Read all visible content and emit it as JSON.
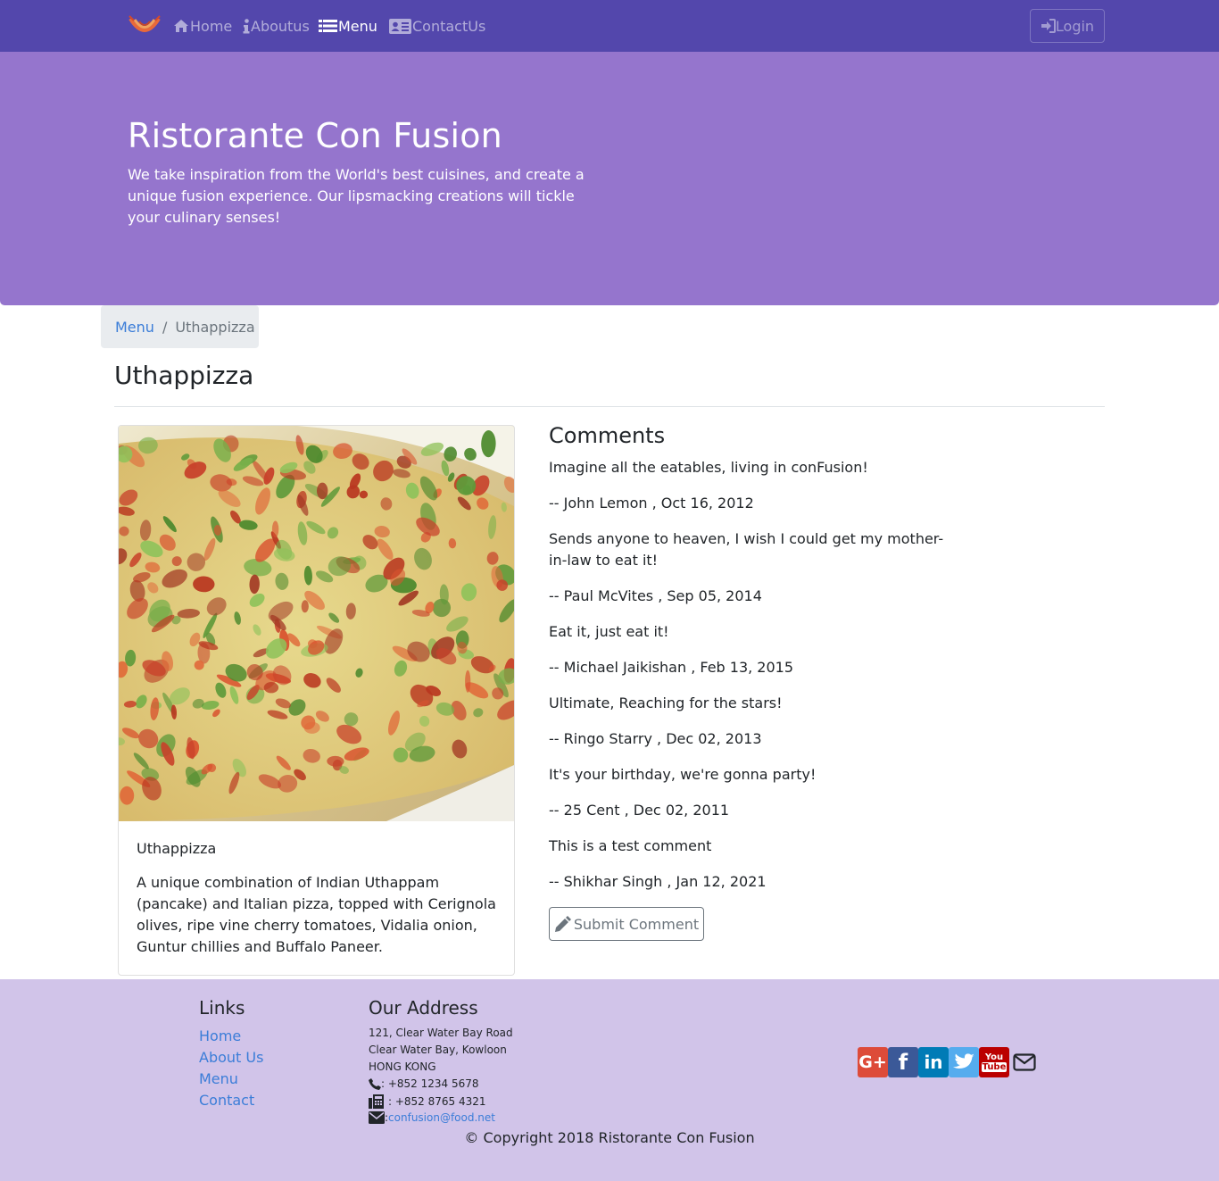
{
  "nav": {
    "home": "Home",
    "aboutus": "Aboutus",
    "menu": "Menu",
    "contactus": "ContactUs",
    "login": "Login"
  },
  "jumbotron": {
    "title": "Ristorante Con Fusion",
    "text": "We take inspiration from the World's best cuisines, and create a unique fusion experience. Our lipsmacking creations will tickle your culinary senses!"
  },
  "breadcrumb": {
    "menu": "Menu",
    "separator": "/",
    "current": "Uthappizza"
  },
  "dish": {
    "title": "Uthappizza",
    "name": "Uthappizza",
    "description": "A unique combination of Indian Uthappam (pancake) and Italian pizza, topped with Cerignola olives, ripe vine cherry tomatoes, Vidalia onion, Guntur chillies and Buffalo Paneer."
  },
  "comments": {
    "heading": "Comments",
    "items": [
      {
        "text": "Imagine all the eatables, living in conFusion!",
        "byline": "-- John Lemon , Oct 16, 2012"
      },
      {
        "text": "Sends anyone to heaven, I wish I could get my mother-in-law to eat it!",
        "byline": "-- Paul McVites , Sep 05, 2014"
      },
      {
        "text": "Eat it, just eat it!",
        "byline": "-- Michael Jaikishan , Feb 13, 2015"
      },
      {
        "text": "Ultimate, Reaching for the stars!",
        "byline": "-- Ringo Starry , Dec 02, 2013"
      },
      {
        "text": "It's your birthday, we're gonna party!",
        "byline": "-- 25 Cent , Dec 02, 2011"
      },
      {
        "text": "This is a test comment",
        "byline": "-- Shikhar Singh , Jan 12, 2021"
      }
    ],
    "submit_label": "Submit Comment"
  },
  "footer": {
    "links_heading": "Links",
    "links": [
      "Home",
      "About Us",
      "Menu",
      "Contact"
    ],
    "address_heading": "Our Address",
    "address_lines": [
      "121, Clear Water Bay Road",
      "Clear Water Bay, Kowloon",
      "HONG KONG"
    ],
    "phone": ": +852 1234 5678",
    "fax": ": +852 8765 4321",
    "email_prefix": ": ",
    "email": "confusion@food.net",
    "social_icons": [
      "google-plus-icon",
      "facebook-icon",
      "linkedin-icon",
      "twitter-icon",
      "youtube-icon",
      "envelope-icon"
    ],
    "social_labels": {
      "google": "G+",
      "facebook": "f",
      "linkedin": "in",
      "youtube_top": "You",
      "youtube_bottom": "Tube"
    },
    "copyright": "© Copyright 2018 Ristorante Con Fusion"
  },
  "colors": {
    "navbar": "#5347AC",
    "jumbotron": "#9575CD",
    "footer": "#D1C4E9",
    "link": "#3b7dd8",
    "google": "#dd4b39",
    "facebook": "#3b5998",
    "linkedin": "#007bb6",
    "twitter": "#55acee",
    "youtube": "#bb0000"
  }
}
